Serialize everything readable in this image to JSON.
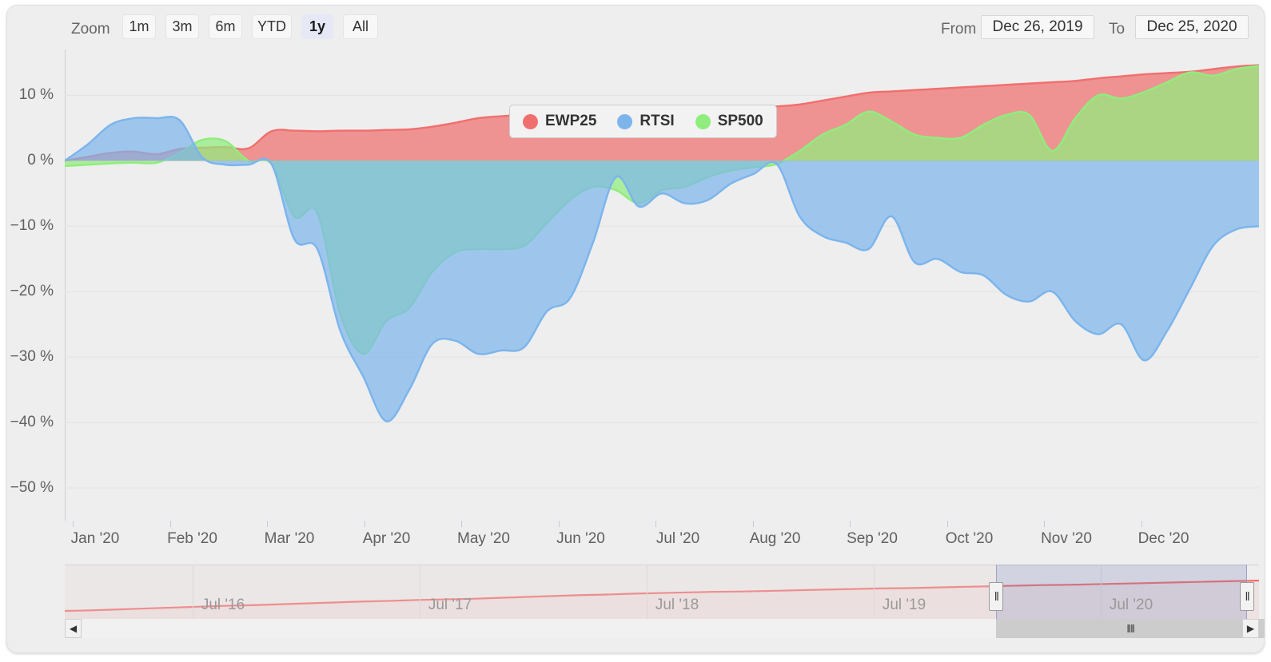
{
  "range_selector": {
    "zoom_label": "Zoom",
    "buttons": [
      {
        "label": "1m",
        "active": false
      },
      {
        "label": "3m",
        "active": false
      },
      {
        "label": "6m",
        "active": false
      },
      {
        "label": "YTD",
        "active": false
      },
      {
        "label": "1y",
        "active": true
      },
      {
        "label": "All",
        "active": false
      }
    ],
    "from_label": "From",
    "from_value": "Dec 26, 2019",
    "to_label": "To",
    "to_value": "Dec 25, 2020"
  },
  "legend": {
    "items": [
      {
        "label": "EWP25",
        "color": "#F0706F"
      },
      {
        "label": "RTSI",
        "color": "#7CB5EC"
      },
      {
        "label": "SP500",
        "color": "#90ED7D"
      }
    ]
  },
  "navigator": {
    "xlabels": [
      "Jul '16",
      "Jul '17",
      "Jul '18",
      "Jul '19",
      "Jul '20"
    ],
    "handle_glyph": "‖",
    "scroll_thumb_glyph": "‖‖",
    "arrow_left_glyph": "◀",
    "arrow_right_glyph": "▶",
    "selection_start_pct": 78.0,
    "selection_end_pct": 99.0
  },
  "chart_data": {
    "type": "area",
    "title": "",
    "xlabel": "",
    "ylabel": "",
    "ylim": [
      -55,
      17
    ],
    "yticks": [
      10,
      0,
      -10,
      -20,
      -30,
      -40,
      -50
    ],
    "ytick_labels": [
      "10 %",
      "0 %",
      "−10 %",
      "−20 %",
      "−30 %",
      "−40 %",
      "−50 %"
    ],
    "xtick_labels": [
      "Jan '20",
      "Feb '20",
      "Mar '20",
      "Apr '20",
      "May '20",
      "Jun '20",
      "Jul '20",
      "Aug '20",
      "Sep '20",
      "Oct '20",
      "Nov '20",
      "Dec '20"
    ],
    "grid": true,
    "legend_position": "top-center",
    "x": [
      "2019-12-26",
      "2020-01-05",
      "2020-01-12",
      "2020-01-19",
      "2020-01-26",
      "2020-02-02",
      "2020-02-09",
      "2020-02-16",
      "2020-02-23",
      "2020-03-01",
      "2020-03-08",
      "2020-03-15",
      "2020-03-22",
      "2020-03-29",
      "2020-04-05",
      "2020-04-12",
      "2020-04-19",
      "2020-04-26",
      "2020-05-03",
      "2020-05-10",
      "2020-05-17",
      "2020-05-24",
      "2020-05-31",
      "2020-06-07",
      "2020-06-14",
      "2020-06-21",
      "2020-06-28",
      "2020-07-05",
      "2020-07-12",
      "2020-07-19",
      "2020-07-26",
      "2020-08-02",
      "2020-08-09",
      "2020-08-16",
      "2020-08-23",
      "2020-08-30",
      "2020-09-06",
      "2020-09-13",
      "2020-09-20",
      "2020-09-27",
      "2020-10-04",
      "2020-10-11",
      "2020-10-18",
      "2020-10-25",
      "2020-11-01",
      "2020-11-08",
      "2020-11-15",
      "2020-11-22",
      "2020-11-29",
      "2020-12-06",
      "2020-12-13",
      "2020-12-20",
      "2020-12-25"
    ],
    "series": [
      {
        "name": "EWP25",
        "color": "#F0706F",
        "values": [
          0.0,
          0.6,
          1.2,
          1.4,
          1.0,
          1.8,
          2.0,
          2.1,
          1.9,
          4.5,
          4.6,
          4.5,
          4.6,
          4.6,
          4.7,
          4.8,
          5.2,
          5.8,
          6.5,
          6.8,
          7.0,
          7.1,
          7.2,
          7.3,
          7.4,
          7.5,
          7.6,
          7.7,
          7.8,
          7.9,
          8.0,
          8.3,
          8.6,
          9.2,
          9.8,
          10.4,
          10.6,
          10.8,
          11.0,
          11.2,
          11.4,
          11.6,
          11.8,
          12.0,
          12.2,
          12.6,
          12.9,
          13.2,
          13.4,
          13.6,
          14.0,
          14.4,
          14.6
        ]
      },
      {
        "name": "RTSI",
        "color": "#7CB5EC",
        "values": [
          0.0,
          2.5,
          5.5,
          6.5,
          6.5,
          6.2,
          0.5,
          -0.6,
          -0.6,
          -0.5,
          -12.0,
          -13.5,
          -26.0,
          -33.0,
          -39.8,
          -35.0,
          -28.0,
          -27.5,
          -29.5,
          -29.0,
          -28.5,
          -23.0,
          -21.0,
          -12.5,
          -2.5,
          -7.0,
          -5.0,
          -6.5,
          -6.0,
          -3.5,
          -2.0,
          -0.5,
          -8.5,
          -11.5,
          -12.5,
          -13.5,
          -8.5,
          -15.5,
          -15.0,
          -17.0,
          -17.5,
          -20.5,
          -21.5,
          -20.0,
          -24.5,
          -26.5,
          -25.0,
          -30.5,
          -26.0,
          -19.5,
          -13.0,
          -10.5,
          -10.0
        ]
      },
      {
        "name": "SP500",
        "color": "#90ED7D",
        "values": [
          -0.8,
          -0.6,
          -0.4,
          -0.3,
          -0.3,
          1.2,
          3.2,
          3.0,
          0.0,
          -0.5,
          -8.5,
          -8.0,
          -23.5,
          -29.5,
          -24.5,
          -22.5,
          -17.0,
          -14.0,
          -13.5,
          -13.5,
          -13.0,
          -9.5,
          -6.0,
          -4.0,
          -4.5,
          -6.5,
          -4.5,
          -4.0,
          -2.5,
          -1.5,
          -1.0,
          -0.5,
          1.5,
          4.0,
          5.5,
          7.5,
          6.0,
          4.0,
          3.5,
          3.5,
          5.5,
          7.0,
          7.0,
          1.5,
          6.5,
          10.0,
          9.5,
          10.5,
          12.0,
          13.5,
          13.0,
          14.0,
          14.5
        ]
      }
    ]
  }
}
